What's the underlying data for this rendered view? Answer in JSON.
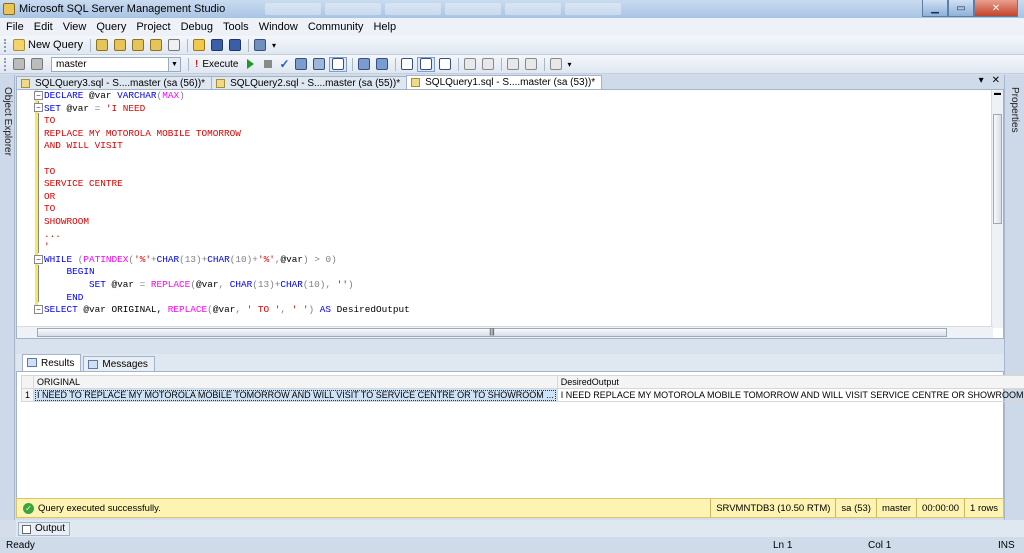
{
  "window": {
    "title": "Microsoft SQL Server Management Studio"
  },
  "menu": [
    "File",
    "Edit",
    "View",
    "Query",
    "Project",
    "Debug",
    "Tools",
    "Window",
    "Community",
    "Help"
  ],
  "toolbar1": {
    "new_query": "New Query"
  },
  "toolbar2": {
    "database": "master",
    "execute": "Execute"
  },
  "side_panels": {
    "left": "Object Explorer",
    "right": "Properties"
  },
  "doc_tabs": [
    {
      "label": "SQLQuery3.sql - S....master (sa (56))*",
      "active": false
    },
    {
      "label": "SQLQuery2.sql - S....master (sa (55))*",
      "active": false
    },
    {
      "label": "SQLQuery1.sql - S....master (sa (53))*",
      "active": true
    }
  ],
  "editor": {
    "lines": [
      [
        {
          "t": "DECLARE",
          "c": "kw"
        },
        {
          "t": " @var ",
          "c": "pl"
        },
        {
          "t": "VARCHAR",
          "c": "kw"
        },
        {
          "t": "(",
          "c": "op"
        },
        {
          "t": "MAX",
          "c": "fn"
        },
        {
          "t": ")",
          "c": "op"
        }
      ],
      [
        {
          "t": "SET",
          "c": "kw"
        },
        {
          "t": " @var ",
          "c": "pl"
        },
        {
          "t": "=",
          "c": "op"
        },
        {
          "t": " 'I NEED",
          "c": "str"
        }
      ],
      [
        {
          "t": "TO",
          "c": "str"
        }
      ],
      [
        {
          "t": "REPLACE MY MOTOROLA MOBILE TOMORROW",
          "c": "str"
        }
      ],
      [
        {
          "t": "AND WILL VISIT",
          "c": "str"
        }
      ],
      [
        {
          "t": "",
          "c": "pl"
        }
      ],
      [
        {
          "t": "TO",
          "c": "str"
        }
      ],
      [
        {
          "t": "SERVICE CENTRE",
          "c": "str"
        }
      ],
      [
        {
          "t": "OR",
          "c": "str"
        }
      ],
      [
        {
          "t": "TO",
          "c": "str"
        }
      ],
      [
        {
          "t": "SHOWROOM",
          "c": "str"
        }
      ],
      [
        {
          "t": "...",
          "c": "str"
        }
      ],
      [
        {
          "t": "'",
          "c": "str"
        }
      ],
      [
        {
          "t": "WHILE",
          "c": "kw"
        },
        {
          "t": " (",
          "c": "op"
        },
        {
          "t": "PATINDEX",
          "c": "fn"
        },
        {
          "t": "(",
          "c": "op"
        },
        {
          "t": "'%'",
          "c": "str"
        },
        {
          "t": "+",
          "c": "op"
        },
        {
          "t": "CHAR",
          "c": "kw"
        },
        {
          "t": "(13)",
          "c": "op"
        },
        {
          "t": "+",
          "c": "op"
        },
        {
          "t": "CHAR",
          "c": "kw"
        },
        {
          "t": "(10)",
          "c": "op"
        },
        {
          "t": "+",
          "c": "op"
        },
        {
          "t": "'%'",
          "c": "str"
        },
        {
          "t": ",",
          "c": "op"
        },
        {
          "t": "@var",
          "c": "pl"
        },
        {
          "t": ")",
          "c": "op"
        },
        {
          "t": " > 0)",
          "c": "op"
        }
      ],
      [
        {
          "t": "    BEGIN",
          "c": "kw"
        }
      ],
      [
        {
          "t": "        SET",
          "c": "kw"
        },
        {
          "t": " @var ",
          "c": "pl"
        },
        {
          "t": "=",
          "c": "op"
        },
        {
          "t": " REPLACE",
          "c": "fn"
        },
        {
          "t": "(",
          "c": "op"
        },
        {
          "t": "@var",
          "c": "pl"
        },
        {
          "t": ", ",
          "c": "op"
        },
        {
          "t": "CHAR",
          "c": "kw"
        },
        {
          "t": "(13)",
          "c": "op"
        },
        {
          "t": "+",
          "c": "op"
        },
        {
          "t": "CHAR",
          "c": "kw"
        },
        {
          "t": "(10), ",
          "c": "op"
        },
        {
          "t": "''",
          "c": "str"
        },
        {
          "t": ")",
          "c": "op"
        }
      ],
      [
        {
          "t": "    END",
          "c": "kw"
        }
      ],
      [
        {
          "t": "SELECT",
          "c": "kw"
        },
        {
          "t": " @var ORIGINAL, ",
          "c": "pl"
        },
        {
          "t": "REPLACE",
          "c": "fn"
        },
        {
          "t": "(",
          "c": "op"
        },
        {
          "t": "@var",
          "c": "pl"
        },
        {
          "t": ", ",
          "c": "op"
        },
        {
          "t": "' TO '",
          "c": "str"
        },
        {
          "t": ", ",
          "c": "op"
        },
        {
          "t": "' '",
          "c": "str"
        },
        {
          "t": ") ",
          "c": "op"
        },
        {
          "t": "AS",
          "c": "kw"
        },
        {
          "t": " DesiredOutput",
          "c": "pl"
        }
      ]
    ]
  },
  "results": {
    "tabs": [
      "Results",
      "Messages"
    ],
    "columns": [
      "ORIGINAL",
      "DesiredOutput"
    ],
    "rows": [
      {
        "num": "1",
        "original": "I NEED TO REPLACE MY MOTOROLA MOBILE TOMORROW AND WILL VISIT TO SERVICE CENTRE OR TO SHOWROOM ...",
        "desired": "I NEED REPLACE MY MOTOROLA MOBILE TOMORROW AND WILL VISIT SERVICE CENTRE OR SHOWROOM ..."
      }
    ]
  },
  "query_status": {
    "message": "Query executed successfully.",
    "server": "SRVMNTDB3 (10.50 RTM)",
    "user": "sa (53)",
    "database": "master",
    "elapsed": "00:00:00",
    "rows": "1 rows"
  },
  "output_tab": "Output",
  "statusbar": {
    "state": "Ready",
    "line": "Ln 1",
    "col": "Col 1",
    "mode": "INS"
  }
}
